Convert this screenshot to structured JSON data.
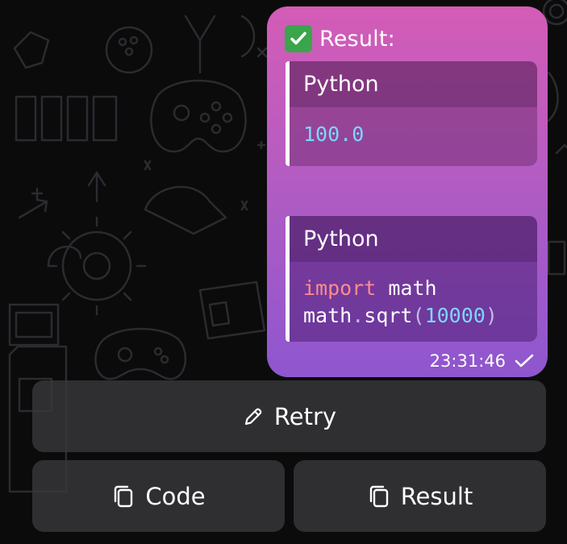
{
  "message": {
    "header_emoji": "check-mark-button",
    "header_title": "Result:",
    "blocks": [
      {
        "language": "Python",
        "lines": [
          [
            {
              "t": "100.0",
              "c": "num"
            }
          ]
        ]
      },
      {
        "language": "Python",
        "lines": [
          [
            {
              "t": "import",
              "c": "kw"
            },
            {
              "t": " math",
              "c": "plain"
            }
          ],
          [
            {
              "t": "math",
              "c": "plain"
            },
            {
              "t": ".",
              "c": "punct"
            },
            {
              "t": "sqrt",
              "c": "plain"
            },
            {
              "t": "(",
              "c": "punct"
            },
            {
              "t": "10000",
              "c": "num"
            },
            {
              "t": ")",
              "c": "punct"
            }
          ]
        ]
      }
    ],
    "time": "23:31:46",
    "status_icon": "read-check-icon"
  },
  "keyboard": {
    "retry": {
      "label": "Retry",
      "icon": "pencil-icon"
    },
    "code": {
      "label": "Code",
      "icon": "copy-icon"
    },
    "result": {
      "label": "Result",
      "icon": "copy-icon"
    }
  },
  "colors": {
    "background": "#0b0b0c",
    "bubble_top": "#d45cb6",
    "bubble_bottom": "#8e56cf",
    "code_number": "#7dd6ff",
    "code_keyword": "#ff8c8c",
    "check_green": "#3aa54a",
    "button_bg": "#3a3a3c"
  }
}
